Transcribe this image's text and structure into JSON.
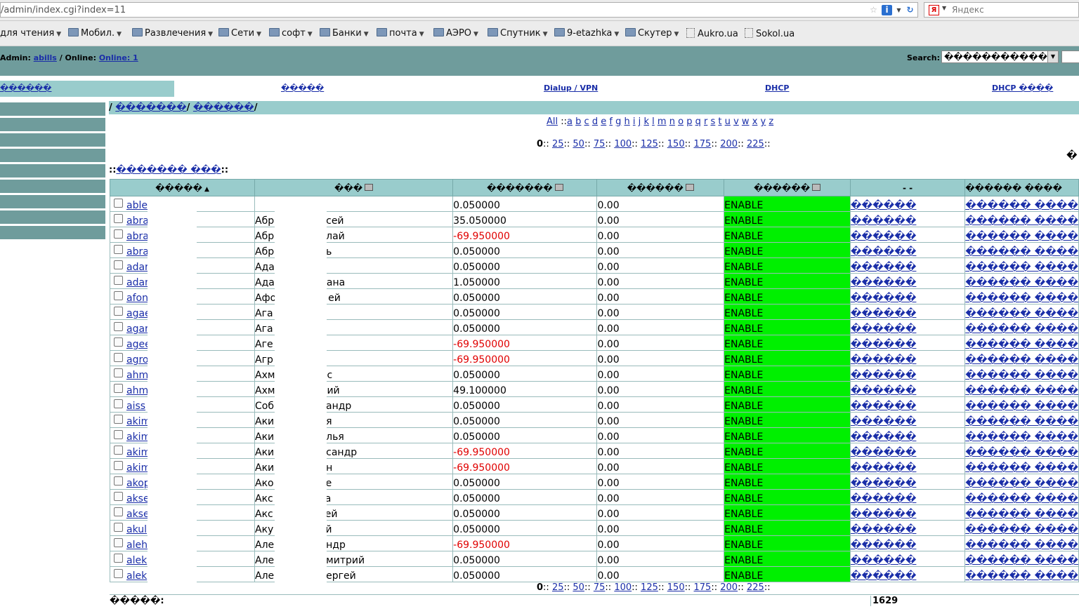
{
  "browser": {
    "url": "/admin/index.cgi?index=11",
    "search_engine": "Яндекс"
  },
  "bookmarks": [
    {
      "label": "для чтения",
      "icon": "none",
      "dropdown": true
    },
    {
      "label": "Мобил.",
      "icon": "folder-icon",
      "dropdown": true
    },
    {
      "label": "Развлечения",
      "icon": "folder-icon",
      "dropdown": true
    },
    {
      "label": "Сети",
      "icon": "folder-icon",
      "dropdown": true
    },
    {
      "label": "софт",
      "icon": "folder-icon",
      "dropdown": true
    },
    {
      "label": "Банки",
      "icon": "folder-icon",
      "dropdown": true
    },
    {
      "label": "почта",
      "icon": "folder-icon",
      "dropdown": true
    },
    {
      "label": "АЭРО",
      "icon": "folder-icon",
      "dropdown": true
    },
    {
      "label": "Спутник",
      "icon": "folder-icon",
      "dropdown": true
    },
    {
      "label": "9-etazhka",
      "icon": "folder-icon",
      "dropdown": true
    },
    {
      "label": "Скутер",
      "icon": "folder-icon",
      "dropdown": true
    },
    {
      "label": "Aukro.ua",
      "icon": "page-icon",
      "dropdown": false
    },
    {
      "label": "Sokol.ua",
      "icon": "page-icon",
      "dropdown": false
    }
  ],
  "admin": {
    "prefix": "Admin:",
    "user": "abills",
    "online_prefix": "/ Online:",
    "online_link": "Online: 1"
  },
  "search": {
    "label": "Search:",
    "selected": "������������"
  },
  "menu": {
    "active": "������",
    "items": [
      "�����",
      "Dialup / VPN",
      "DHCP",
      "DHCP ����"
    ]
  },
  "breadcrumb": {
    "sep1": "/",
    "link1": "�������",
    "sep2": "/",
    "link2": "������",
    "sep3": "/"
  },
  "letters": [
    "All",
    "a",
    "b",
    "c",
    "d",
    "e",
    "f",
    "g",
    "h",
    "i",
    "j",
    "k",
    "l",
    "m",
    "n",
    "o",
    "p",
    "q",
    "r",
    "s",
    "t",
    "u",
    "v",
    "w",
    "x",
    "y",
    "z"
  ],
  "letters_sep": "::",
  "pager": {
    "current": "0",
    "links": [
      "25",
      "50",
      "75",
      "100",
      "125",
      "150",
      "175",
      "200",
      "225"
    ]
  },
  "edge_mark": "�",
  "list_link": "������� ���",
  "table": {
    "headers": [
      "�����",
      "���",
      "�������",
      "������",
      "������",
      "- -",
      "������ ����"
    ],
    "status_color": "#00f000",
    "negative_color": "#e00000",
    "action1": "������",
    "action2": "������ ����",
    "rows": [
      {
        "login": "able",
        "fio": "",
        "deposit": "0.050000",
        "credit": "0.00",
        "status": "ENABLE"
      },
      {
        "login": "abra",
        "fio": "Абр",
        "fio_tail": "сей",
        "deposit": "35.050000",
        "credit": "0.00",
        "status": "ENABLE"
      },
      {
        "login": "abra",
        "fio": "Абр",
        "fio_tail": "лай",
        "deposit": "-69.950000",
        "credit": "0.00",
        "status": "ENABLE"
      },
      {
        "login": "abra",
        "fio": "Абр",
        "fio_tail": "ь",
        "deposit": "0.050000",
        "credit": "0.00",
        "status": "ENABLE"
      },
      {
        "login": "adar",
        "fio": "Ада",
        "fio_tail": "",
        "deposit": "0.050000",
        "credit": "0.00",
        "status": "ENABLE"
      },
      {
        "login": "adam",
        "fio": "Ада",
        "fio_tail": "ана",
        "deposit": "1.050000",
        "credit": "0.00",
        "status": "ENABLE"
      },
      {
        "login": "afon",
        "fio": "Афо",
        "fio_tail": "ей",
        "deposit": "0.050000",
        "credit": "0.00",
        "status": "ENABLE"
      },
      {
        "login": "agae",
        "fio": "Ага",
        "fio_tail": "",
        "deposit": "0.050000",
        "credit": "0.00",
        "status": "ENABLE"
      },
      {
        "login": "agar",
        "fio": "Ага",
        "fio_tail": "",
        "deposit": "0.050000",
        "credit": "0.00",
        "status": "ENABLE"
      },
      {
        "login": "agee",
        "fio": "Аге",
        "fio_tail": "",
        "deposit": "-69.950000",
        "credit": "0.00",
        "status": "ENABLE"
      },
      {
        "login": "agro",
        "fio": "Агр",
        "fio_tail": "",
        "deposit": "-69.950000",
        "credit": "0.00",
        "status": "ENABLE"
      },
      {
        "login": "ahm",
        "fio": "Ахм",
        "fio_tail": "с",
        "deposit": "0.050000",
        "credit": "0.00",
        "status": "ENABLE"
      },
      {
        "login": "ahm",
        "fio": "Ахм",
        "fio_tail": "ий",
        "deposit": "49.100000",
        "credit": "0.00",
        "status": "ENABLE"
      },
      {
        "login": "aiss",
        "fio": "Соб",
        "fio_tail": "андр",
        "deposit": "0.050000",
        "credit": "0.00",
        "status": "ENABLE"
      },
      {
        "login": "akim",
        "fio": "Аки",
        "fio_tail": "я",
        "deposit": "0.050000",
        "credit": "0.00",
        "status": "ENABLE"
      },
      {
        "login": "akim",
        "fio": "Аки",
        "fio_tail": "лья",
        "deposit": "0.050000",
        "credit": "0.00",
        "status": "ENABLE"
      },
      {
        "login": "akim",
        "fio": "Аки",
        "fio_tail": "сандр",
        "deposit": "-69.950000",
        "credit": "0.00",
        "status": "ENABLE"
      },
      {
        "login": "akim",
        "fio": "Аки",
        "fio_tail": "н",
        "deposit": "-69.950000",
        "credit": "0.00",
        "status": "ENABLE"
      },
      {
        "login": "akop",
        "fio": "Ако",
        "fio_tail": "е",
        "deposit": "0.050000",
        "credit": "0.00",
        "status": "ENABLE"
      },
      {
        "login": "akse",
        "fio": "Акс",
        "fio_tail": "а",
        "deposit": "0.050000",
        "credit": "0.00",
        "status": "ENABLE"
      },
      {
        "login": "akse",
        "fio": "Акс",
        "fio_tail": "ей",
        "deposit": "0.050000",
        "credit": "0.00",
        "status": "ENABLE"
      },
      {
        "login": "akul",
        "fio": "Аку",
        "fio_tail": "й",
        "deposit": "0.050000",
        "credit": "0.00",
        "status": "ENABLE"
      },
      {
        "login": "aleh",
        "fio": "Але",
        "fio_tail": "ндр",
        "deposit": "-69.950000",
        "credit": "0.00",
        "status": "ENABLE"
      },
      {
        "login": "alek",
        "fio": "Але",
        "fio_tail": "митрий",
        "deposit": "0.050000",
        "credit": "0.00",
        "status": "ENABLE"
      },
      {
        "login": "alek",
        "fio": "Але",
        "fio_tail": "ергей",
        "deposit": "0.050000",
        "credit": "0.00",
        "status": "ENABLE"
      }
    ]
  },
  "footer": {
    "label": "�����:",
    "total": "1629"
  }
}
